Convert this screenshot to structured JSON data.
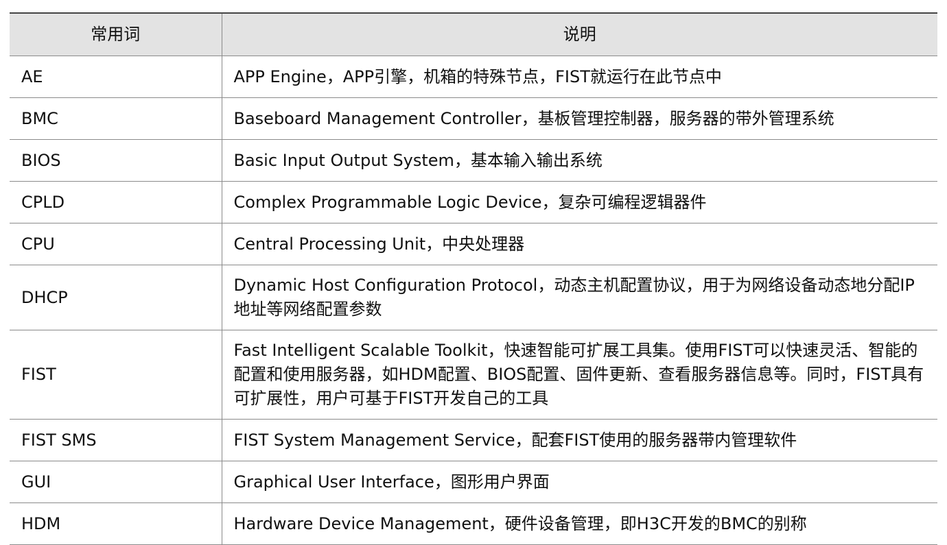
{
  "table": {
    "headers": {
      "term": "常用词",
      "description": "说明"
    },
    "rows": [
      {
        "term": "AE",
        "description": "APP Engine，APP引擎，机箱的特殊节点，FIST就运行在此节点中"
      },
      {
        "term": "BMC",
        "description": "Baseboard Management Controller，基板管理控制器，服务器的带外管理系统"
      },
      {
        "term": "BIOS",
        "description": "Basic Input Output System，基本输入输出系统"
      },
      {
        "term": "CPLD",
        "description": "Complex Programmable Logic Device，复杂可编程逻辑器件"
      },
      {
        "term": "CPU",
        "description": "Central Processing Unit，中央处理器"
      },
      {
        "term": "DHCP",
        "description": "Dynamic Host Configuration Protocol，动态主机配置协议，用于为网络设备动态地分配IP地址等网络配置参数"
      },
      {
        "term": "FIST",
        "description": "Fast Intelligent Scalable Toolkit，快速智能可扩展工具集。使用FIST可以快速灵活、智能的配置和使用服务器，如HDM配置、BIOS配置、固件更新、查看服务器信息等。同时，FIST具有可扩展性，用户可基于FIST开发自己的工具"
      },
      {
        "term": "FIST SMS",
        "description": "FIST System Management Service，配套FIST使用的服务器带内管理软件"
      },
      {
        "term": "GUI",
        "description": "Graphical User Interface，图形用户界面"
      },
      {
        "term": "HDM",
        "description": "Hardware Device Management，硬件设备管理，即H3C开发的BMC的别称"
      }
    ]
  }
}
